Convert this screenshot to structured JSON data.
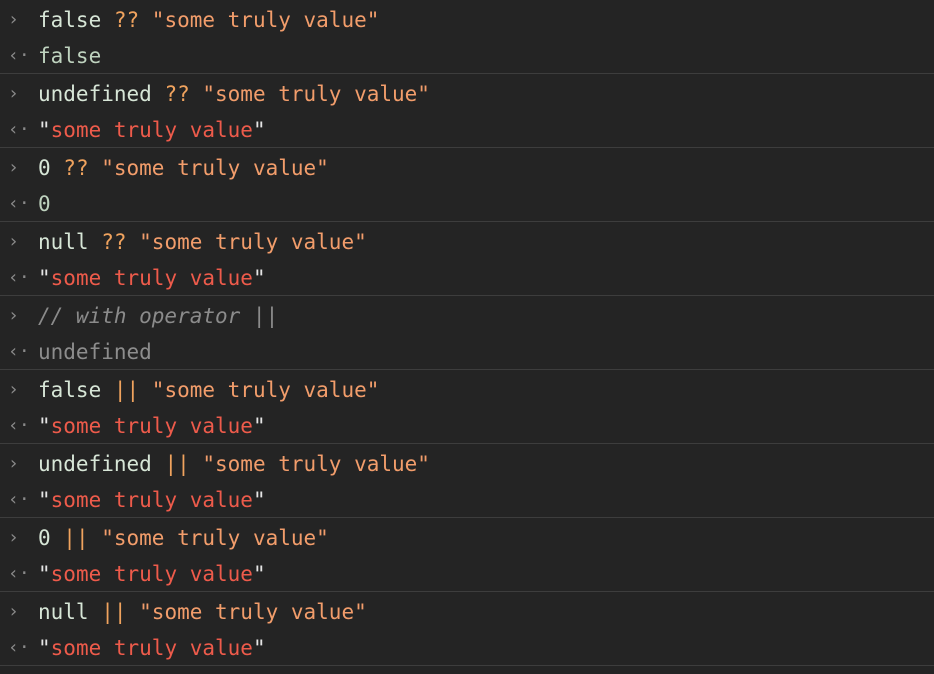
{
  "prompt_in": "›",
  "prompt_out": "‹·",
  "entries": [
    {
      "input": [
        {
          "t": "false ",
          "c": "t-plain"
        },
        {
          "t": "??",
          "c": "t-op"
        },
        {
          "t": " \"some truly value\"",
          "c": "t-str"
        }
      ],
      "output": [
        {
          "t": "false",
          "c": "r-plain"
        }
      ]
    },
    {
      "input": [
        {
          "t": "undefined ",
          "c": "t-plain"
        },
        {
          "t": "??",
          "c": "t-op"
        },
        {
          "t": " \"some truly value\"",
          "c": "t-str"
        }
      ],
      "output": [
        {
          "t": "\"",
          "c": "r-quote"
        },
        {
          "t": "some truly value",
          "c": "r-str"
        },
        {
          "t": "\"",
          "c": "r-quote"
        }
      ]
    },
    {
      "input": [
        {
          "t": "0 ",
          "c": "t-plain"
        },
        {
          "t": "??",
          "c": "t-op"
        },
        {
          "t": " \"some truly value\"",
          "c": "t-str"
        }
      ],
      "output": [
        {
          "t": "0",
          "c": "r-plain"
        }
      ]
    },
    {
      "input": [
        {
          "t": "null ",
          "c": "t-plain"
        },
        {
          "t": "??",
          "c": "t-op"
        },
        {
          "t": " \"some truly value\"",
          "c": "t-str"
        }
      ],
      "output": [
        {
          "t": "\"",
          "c": "r-quote"
        },
        {
          "t": "some truly value",
          "c": "r-str"
        },
        {
          "t": "\"",
          "c": "r-quote"
        }
      ]
    },
    {
      "input": [
        {
          "t": "// with operator ||",
          "c": "t-comment"
        }
      ],
      "output": [
        {
          "t": "undefined",
          "c": "r-undef"
        }
      ]
    },
    {
      "input": [
        {
          "t": "false ",
          "c": "t-plain"
        },
        {
          "t": "||",
          "c": "t-op"
        },
        {
          "t": " \"some truly value\"",
          "c": "t-str"
        }
      ],
      "output": [
        {
          "t": "\"",
          "c": "r-quote"
        },
        {
          "t": "some truly value",
          "c": "r-str"
        },
        {
          "t": "\"",
          "c": "r-quote"
        }
      ]
    },
    {
      "input": [
        {
          "t": "undefined ",
          "c": "t-plain"
        },
        {
          "t": "||",
          "c": "t-op"
        },
        {
          "t": " \"some truly value\"",
          "c": "t-str"
        }
      ],
      "output": [
        {
          "t": "\"",
          "c": "r-quote"
        },
        {
          "t": "some truly value",
          "c": "r-str"
        },
        {
          "t": "\"",
          "c": "r-quote"
        }
      ]
    },
    {
      "input": [
        {
          "t": "0 ",
          "c": "t-plain"
        },
        {
          "t": "||",
          "c": "t-op"
        },
        {
          "t": " \"some truly value\"",
          "c": "t-str"
        }
      ],
      "output": [
        {
          "t": "\"",
          "c": "r-quote"
        },
        {
          "t": "some truly value",
          "c": "r-str"
        },
        {
          "t": "\"",
          "c": "r-quote"
        }
      ]
    },
    {
      "input": [
        {
          "t": "null ",
          "c": "t-plain"
        },
        {
          "t": "||",
          "c": "t-op"
        },
        {
          "t": " \"some truly value\"",
          "c": "t-str"
        }
      ],
      "output": [
        {
          "t": "\"",
          "c": "r-quote"
        },
        {
          "t": "some truly value",
          "c": "r-str"
        },
        {
          "t": "\"",
          "c": "r-quote"
        }
      ]
    }
  ],
  "colors": {
    "background": "#242424",
    "separator": "#3d3d3d",
    "string_input": "#f29d6b",
    "string_result": "#ee5b4b",
    "comment": "#8b8b8b"
  }
}
